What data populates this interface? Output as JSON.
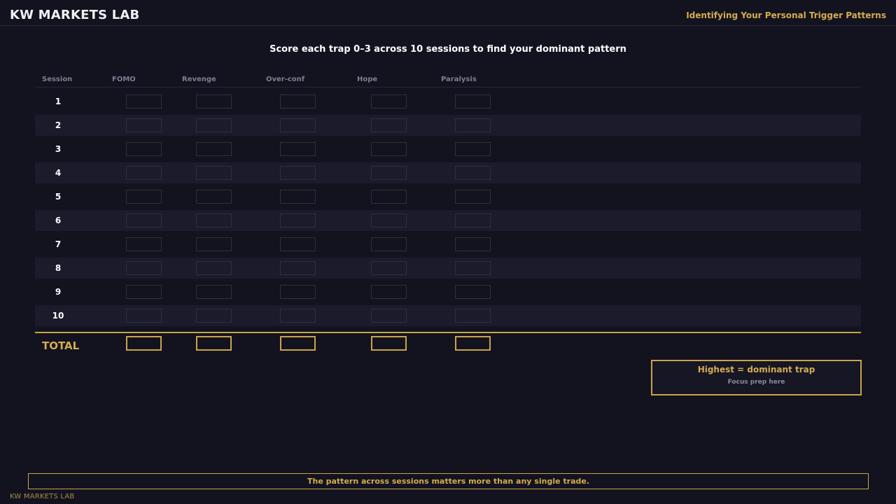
{
  "header": {
    "brand": "KW MARKETS LAB",
    "subtitle": "Identifying Your Personal Trigger Patterns"
  },
  "instruction": "Score each trap 0–3 across 10 sessions to find your dominant pattern",
  "table": {
    "columns": [
      "Session",
      "FOMO",
      "Revenge",
      "Over-conf",
      "Hope",
      "Paralysis"
    ],
    "sessions": [
      "1",
      "2",
      "3",
      "4",
      "5",
      "6",
      "7",
      "8",
      "9",
      "10"
    ],
    "total_label": "TOTAL"
  },
  "callout": {
    "title": "Highest = dominant trap",
    "subtitle": "Focus prep here"
  },
  "footer": {
    "note": "The pattern across sessions matters more than any single trade.",
    "brand": "KW MARKETS LAB"
  },
  "colors": {
    "background": "#13131f",
    "accent": "#c9a449",
    "row_alt": "#1b1b2b"
  }
}
